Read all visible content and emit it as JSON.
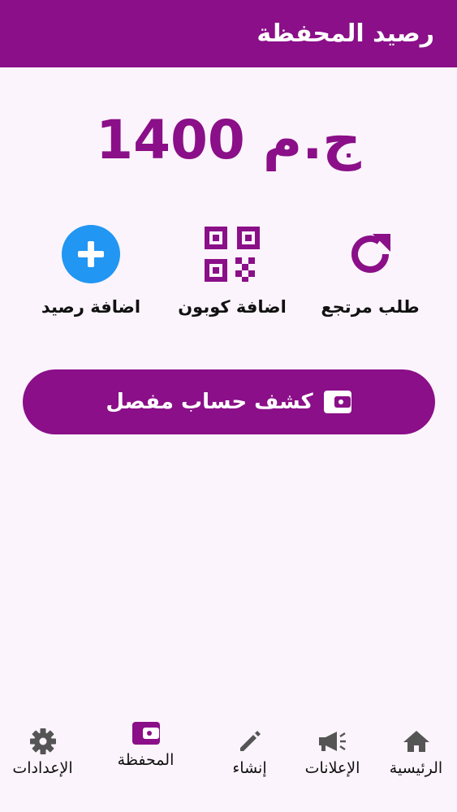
{
  "app_bar": {
    "title": "رصيد المحفظة"
  },
  "balance": {
    "amount": "1400",
    "currency": "ج.م"
  },
  "actions": [
    {
      "label": "طلب مرتجع",
      "icon": "refresh-icon"
    },
    {
      "label": "اضافة كوبون",
      "icon": "qr-code-icon"
    },
    {
      "label": "اضافة رصيد",
      "icon": "plus-circle-icon"
    }
  ],
  "statement_button": {
    "label": "كشف حساب مفصل",
    "icon": "wallet-icon"
  },
  "bottom_nav": {
    "items": [
      {
        "label": "الرئيسية",
        "icon": "home-icon"
      },
      {
        "label": "الإعلانات",
        "icon": "megaphone-icon"
      },
      {
        "label": "إنشاء",
        "icon": "pencil-icon"
      },
      {
        "label": "المحفظة",
        "icon": "wallet-icon",
        "active": true
      },
      {
        "label": "الإعدادات",
        "icon": "gear-icon"
      }
    ]
  },
  "colors": {
    "primary": "#8a0f88",
    "accent_blue": "#2196f3",
    "background": "#fcf4fc"
  }
}
